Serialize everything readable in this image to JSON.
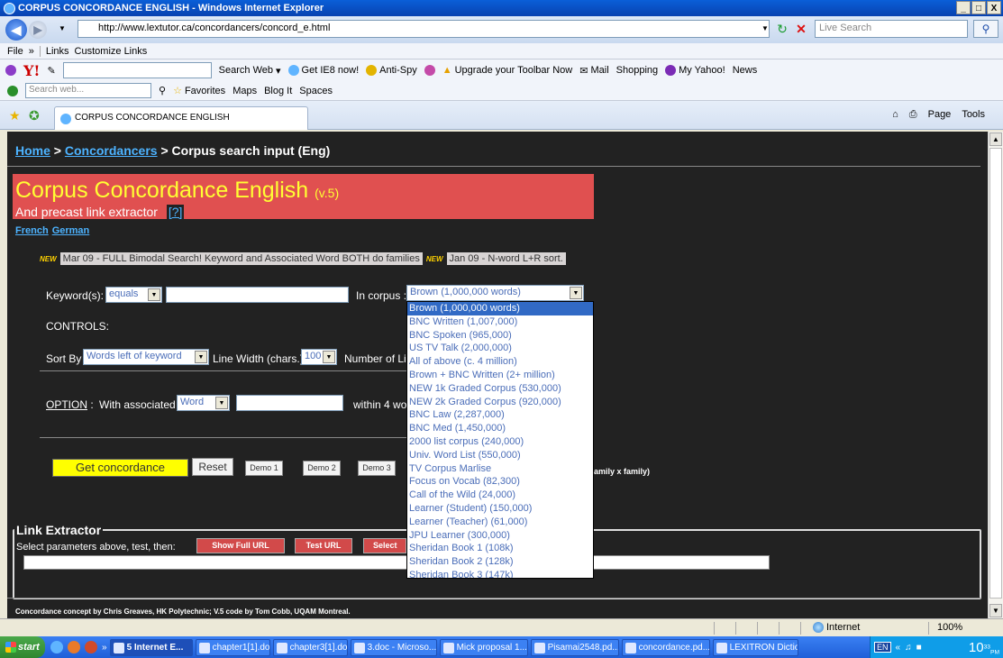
{
  "window": {
    "title": "CORPUS CONCORDANCE ENGLISH - Windows Internet Explorer",
    "minimize": "_",
    "maximize": "□",
    "close": "X"
  },
  "address": {
    "url": "http://www.lextutor.ca/concordancers/concord_e.html",
    "live_search_placeholder": "Live Search"
  },
  "links_bar": {
    "file": "File",
    "chevron": "»",
    "links": "Links",
    "customize": "Customize Links"
  },
  "yahoo_toolbar": {
    "logo": "Y!",
    "search_web": "Search Web",
    "get_ie8": "Get IE8 now!",
    "anti_spy": "Anti-Spy",
    "upgrade": "Upgrade your Toolbar Now",
    "mail": "Mail",
    "shopping": "Shopping",
    "my_yahoo": "My Yahoo!",
    "news": "News"
  },
  "msn_toolbar": {
    "search_placeholder": "Search web...",
    "favorites": "Favorites",
    "maps": "Maps",
    "blog_it": "Blog It",
    "spaces": "Spaces"
  },
  "tab": {
    "title": "CORPUS CONCORDANCE ENGLISH",
    "page_menu": "Page",
    "tools_menu": "Tools"
  },
  "page": {
    "breadcrumb": {
      "home": "Home",
      "sep1": " > ",
      "concordancers": "Concordancers",
      "current": " > Corpus search input (Eng)"
    },
    "banner": {
      "title": "Corpus Concordance English",
      "version": "(v.5)",
      "subtitle": "And precast link extractor",
      "help": "[?]"
    },
    "languages": [
      "French",
      "German"
    ],
    "news": [
      {
        "badge": "NEW",
        "text": "Mar 09 - FULL Bimodal Search! Keyword and Associated Word BOTH do families"
      },
      {
        "badge": "NEW",
        "text": "Jan 09 - N-word L+R sort."
      }
    ],
    "form": {
      "keyword_label": "Keyword(s):",
      "keyword_mode": "equals",
      "corpus_label": "In corpus :",
      "corpus_value": "Brown (1,000,000 words)",
      "controls_label": "CONTROLS:",
      "sort_label": "Sort By",
      "sort_value": "Words left of keyword",
      "line_width_label": "Line Width (chars.)",
      "line_width_value": "100",
      "number_label": "Number of Lin",
      "option_label": "OPTION",
      "option_colon": ":",
      "with_assoc_label": "With associated",
      "assoc_value": "Word",
      "within_label": "within 4 wor"
    },
    "corpus_options": [
      "Brown (1,000,000 words)",
      "BNC Written (1,007,000)",
      "BNC Spoken (965,000)",
      "US TV Talk (2,000,000)",
      "All of above (c. 4 million)",
      "Brown + BNC Written (2+ million)",
      "NEW 1k Graded Corpus (530,000)",
      "NEW 2k Graded Corpus (920,000)",
      "BNC Law (2,287,000)",
      "BNC Med (1,450,000)",
      "2000 list corpus (240,000)",
      "Univ. Word List (550,000)",
      "TV Corpus Marlise",
      "Focus on Vocab (82,300)",
      "Call of the Wild (24,000)",
      "Learner (Student) (150,000)",
      "Learner (Teacher) (61,000)",
      "JPU Learner (300,000)",
      "Sheridan Book 1 (108k)",
      "Sheridan Book 2 (128k)",
      "Sheridan Book 3 (147k)"
    ],
    "buttons": {
      "get": "Get concordance",
      "reset": "Reset",
      "demo1": "Demo 1",
      "demo2": "Demo 2",
      "demo3": "Demo 3"
    },
    "family_text": "amily x family)",
    "link_extractor": {
      "legend": "Link Extractor",
      "label": "Select parameters above, test, then:",
      "show_full_url": "Show Full URL",
      "test_url": "Test URL",
      "select": "Select"
    },
    "footer": "Concordance concept by Chris Greaves, HK Polytechnic; V.5 code by Tom Cobb, UQAM Montreal."
  },
  "statusbar": {
    "zone": "Internet",
    "zoom": "100%"
  },
  "taskbar": {
    "start": "start",
    "chevron": "»",
    "tasks": [
      "5 Internet E...",
      "chapter1[1].do...",
      "chapter3[1].do...",
      "3.doc - Microso...",
      "Mick proposal 1...",
      "Pisamai2548.pd...",
      "concordance.pd...",
      "LEXITRON Dictio..."
    ],
    "lang": "EN",
    "tray_chevron": "«",
    "time": "10",
    "time_small": "33",
    "ampm": "PM"
  }
}
